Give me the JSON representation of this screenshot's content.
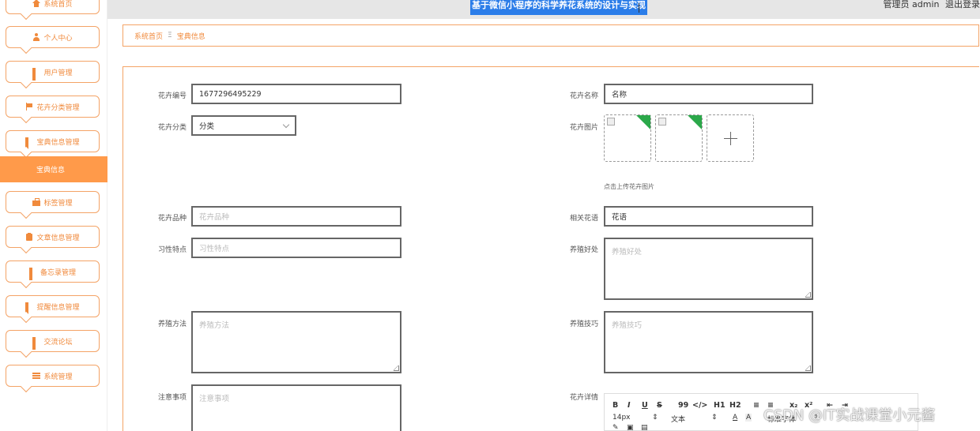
{
  "topbar": {
    "title": "基于微信小程序的科学养花系统的设计与实现",
    "user": "管理员 admin",
    "logout": "退出登录"
  },
  "sidebar": {
    "items": [
      {
        "label": "系统首页",
        "icon": "home-icon"
      },
      {
        "label": "个人中心",
        "icon": "user-icon"
      },
      {
        "label": "用户管理",
        "icon": "grid-icon"
      },
      {
        "label": "花卉分类管理",
        "icon": "flag-icon"
      },
      {
        "label": "宝典信息管理",
        "icon": "grid-icon"
      },
      {
        "label": "标签管理",
        "icon": "briefcase-icon"
      },
      {
        "label": "文章信息管理",
        "icon": "clipboard-icon"
      },
      {
        "label": "备忘录管理",
        "icon": "grid-icon"
      },
      {
        "label": "提醒信息管理",
        "icon": "grid-icon"
      },
      {
        "label": "交流论坛",
        "icon": "grid-icon"
      },
      {
        "label": "系统管理",
        "icon": "menu-icon"
      }
    ],
    "active": "宝典信息"
  },
  "breadcrumb": {
    "home": "系统首页",
    "sep": "Ξ",
    "current": "宝典信息"
  },
  "form": {
    "flower_no": {
      "label": "花卉编号",
      "value": "1677296495229"
    },
    "flower_name": {
      "label": "花卉名称",
      "value": "名称"
    },
    "category": {
      "label": "花卉分类",
      "value": "分类"
    },
    "image": {
      "label": "花卉图片",
      "hint": "点击上传花卉图片"
    },
    "variety": {
      "label": "花卉品种",
      "placeholder": "花卉品种"
    },
    "flower_language": {
      "label": "相关花语",
      "value": "花语"
    },
    "habits": {
      "label": "习性特点",
      "placeholder": "习性特点"
    },
    "benefits": {
      "label": "养殖好处",
      "placeholder": "养殖好处"
    },
    "method": {
      "label": "养殖方法",
      "placeholder": "养殖方法"
    },
    "tips": {
      "label": "养殖技巧",
      "placeholder": "养殖技巧"
    },
    "notes": {
      "label": "注意事项",
      "placeholder": "注意事项"
    },
    "details": {
      "label": "花卉详情"
    }
  },
  "editor": {
    "buttons": [
      "B",
      "I",
      "U",
      "S",
      "99",
      "</>",
      "H1",
      "H2",
      "≡",
      "≡",
      "x₂",
      "x²",
      "⇤",
      "⇥"
    ],
    "font_size": "14px",
    "text_type": "文本",
    "font_family": "标准字体"
  },
  "watermark": "CSDN @IT实战课堂小元酱"
}
